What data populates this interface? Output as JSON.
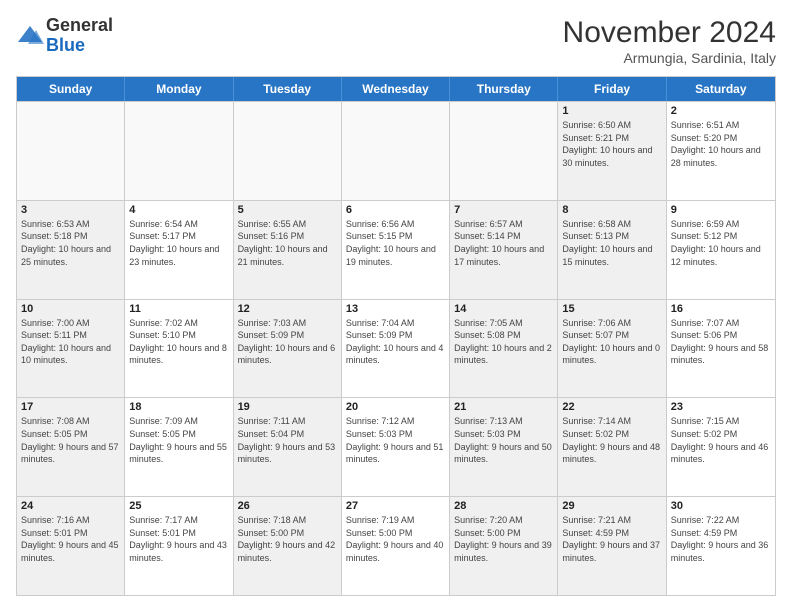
{
  "header": {
    "logo_line1": "General",
    "logo_line2": "Blue",
    "month": "November 2024",
    "location": "Armungia, Sardinia, Italy"
  },
  "days_of_week": [
    "Sunday",
    "Monday",
    "Tuesday",
    "Wednesday",
    "Thursday",
    "Friday",
    "Saturday"
  ],
  "rows": [
    [
      {
        "day": "",
        "info": "",
        "empty": true
      },
      {
        "day": "",
        "info": "",
        "empty": true
      },
      {
        "day": "",
        "info": "",
        "empty": true
      },
      {
        "day": "",
        "info": "",
        "empty": true
      },
      {
        "day": "",
        "info": "",
        "empty": true
      },
      {
        "day": "1",
        "info": "Sunrise: 6:50 AM\nSunset: 5:21 PM\nDaylight: 10 hours and 30 minutes.",
        "shaded": true
      },
      {
        "day": "2",
        "info": "Sunrise: 6:51 AM\nSunset: 5:20 PM\nDaylight: 10 hours and 28 minutes."
      }
    ],
    [
      {
        "day": "3",
        "info": "Sunrise: 6:53 AM\nSunset: 5:18 PM\nDaylight: 10 hours and 25 minutes.",
        "shaded": true
      },
      {
        "day": "4",
        "info": "Sunrise: 6:54 AM\nSunset: 5:17 PM\nDaylight: 10 hours and 23 minutes."
      },
      {
        "day": "5",
        "info": "Sunrise: 6:55 AM\nSunset: 5:16 PM\nDaylight: 10 hours and 21 minutes.",
        "shaded": true
      },
      {
        "day": "6",
        "info": "Sunrise: 6:56 AM\nSunset: 5:15 PM\nDaylight: 10 hours and 19 minutes."
      },
      {
        "day": "7",
        "info": "Sunrise: 6:57 AM\nSunset: 5:14 PM\nDaylight: 10 hours and 17 minutes.",
        "shaded": true
      },
      {
        "day": "8",
        "info": "Sunrise: 6:58 AM\nSunset: 5:13 PM\nDaylight: 10 hours and 15 minutes.",
        "shaded": true
      },
      {
        "day": "9",
        "info": "Sunrise: 6:59 AM\nSunset: 5:12 PM\nDaylight: 10 hours and 12 minutes."
      }
    ],
    [
      {
        "day": "10",
        "info": "Sunrise: 7:00 AM\nSunset: 5:11 PM\nDaylight: 10 hours and 10 minutes.",
        "shaded": true
      },
      {
        "day": "11",
        "info": "Sunrise: 7:02 AM\nSunset: 5:10 PM\nDaylight: 10 hours and 8 minutes."
      },
      {
        "day": "12",
        "info": "Sunrise: 7:03 AM\nSunset: 5:09 PM\nDaylight: 10 hours and 6 minutes.",
        "shaded": true
      },
      {
        "day": "13",
        "info": "Sunrise: 7:04 AM\nSunset: 5:09 PM\nDaylight: 10 hours and 4 minutes."
      },
      {
        "day": "14",
        "info": "Sunrise: 7:05 AM\nSunset: 5:08 PM\nDaylight: 10 hours and 2 minutes.",
        "shaded": true
      },
      {
        "day": "15",
        "info": "Sunrise: 7:06 AM\nSunset: 5:07 PM\nDaylight: 10 hours and 0 minutes.",
        "shaded": true
      },
      {
        "day": "16",
        "info": "Sunrise: 7:07 AM\nSunset: 5:06 PM\nDaylight: 9 hours and 58 minutes."
      }
    ],
    [
      {
        "day": "17",
        "info": "Sunrise: 7:08 AM\nSunset: 5:05 PM\nDaylight: 9 hours and 57 minutes.",
        "shaded": true
      },
      {
        "day": "18",
        "info": "Sunrise: 7:09 AM\nSunset: 5:05 PM\nDaylight: 9 hours and 55 minutes."
      },
      {
        "day": "19",
        "info": "Sunrise: 7:11 AM\nSunset: 5:04 PM\nDaylight: 9 hours and 53 minutes.",
        "shaded": true
      },
      {
        "day": "20",
        "info": "Sunrise: 7:12 AM\nSunset: 5:03 PM\nDaylight: 9 hours and 51 minutes."
      },
      {
        "day": "21",
        "info": "Sunrise: 7:13 AM\nSunset: 5:03 PM\nDaylight: 9 hours and 50 minutes.",
        "shaded": true
      },
      {
        "day": "22",
        "info": "Sunrise: 7:14 AM\nSunset: 5:02 PM\nDaylight: 9 hours and 48 minutes.",
        "shaded": true
      },
      {
        "day": "23",
        "info": "Sunrise: 7:15 AM\nSunset: 5:02 PM\nDaylight: 9 hours and 46 minutes."
      }
    ],
    [
      {
        "day": "24",
        "info": "Sunrise: 7:16 AM\nSunset: 5:01 PM\nDaylight: 9 hours and 45 minutes.",
        "shaded": true
      },
      {
        "day": "25",
        "info": "Sunrise: 7:17 AM\nSunset: 5:01 PM\nDaylight: 9 hours and 43 minutes."
      },
      {
        "day": "26",
        "info": "Sunrise: 7:18 AM\nSunset: 5:00 PM\nDaylight: 9 hours and 42 minutes.",
        "shaded": true
      },
      {
        "day": "27",
        "info": "Sunrise: 7:19 AM\nSunset: 5:00 PM\nDaylight: 9 hours and 40 minutes."
      },
      {
        "day": "28",
        "info": "Sunrise: 7:20 AM\nSunset: 5:00 PM\nDaylight: 9 hours and 39 minutes.",
        "shaded": true
      },
      {
        "day": "29",
        "info": "Sunrise: 7:21 AM\nSunset: 4:59 PM\nDaylight: 9 hours and 37 minutes.",
        "shaded": true
      },
      {
        "day": "30",
        "info": "Sunrise: 7:22 AM\nSunset: 4:59 PM\nDaylight: 9 hours and 36 minutes."
      }
    ]
  ]
}
